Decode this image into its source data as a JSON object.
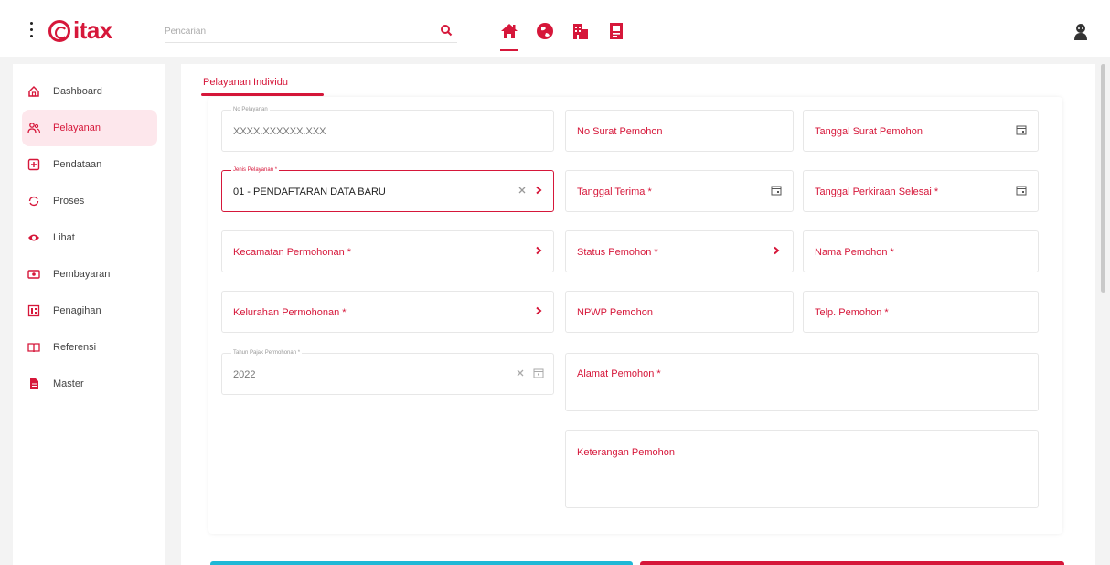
{
  "header": {
    "logo_text": "itax",
    "search": {
      "placeholder": "Pencarian"
    },
    "nav_icons": [
      "home-icon",
      "globe-icon",
      "building-icon",
      "document-icon"
    ],
    "active_nav": "home-icon"
  },
  "sidebar": {
    "items": [
      {
        "label": "Dashboard",
        "icon": "home-outline-icon",
        "active": false
      },
      {
        "label": "Pelayanan",
        "icon": "users-icon",
        "active": true
      },
      {
        "label": "Pendataan",
        "icon": "plus-square-icon",
        "active": false
      },
      {
        "label": "Proses",
        "icon": "refresh-icon",
        "active": false
      },
      {
        "label": "Lihat",
        "icon": "eye-icon",
        "active": false
      },
      {
        "label": "Pembayaran",
        "icon": "money-icon",
        "active": false
      },
      {
        "label": "Penagihan",
        "icon": "bill-icon",
        "active": false
      },
      {
        "label": "Referensi",
        "icon": "book-icon",
        "active": false
      },
      {
        "label": "Master",
        "icon": "file-icon",
        "active": false
      }
    ]
  },
  "tab": {
    "label": "Pelayanan Individu"
  },
  "form": {
    "no_pelayanan": {
      "label": "No Pelayanan",
      "value": "XXXX.XXXXXX.XXX"
    },
    "no_surat": {
      "placeholder": "No Surat Pemohon"
    },
    "tanggal_surat": {
      "placeholder": "Tanggal Surat Pemohon"
    },
    "jenis_pelayanan": {
      "label": "Jenis Pelayanan *",
      "value": "01 - PENDAFTARAN DATA BARU"
    },
    "tanggal_terima": {
      "placeholder": "Tanggal Terima *"
    },
    "tanggal_perkiraan": {
      "placeholder": "Tanggal Perkiraan Selesai *"
    },
    "kecamatan": {
      "placeholder": "Kecamatan Permohonan *"
    },
    "status_pemohon": {
      "placeholder": "Status Pemohon *"
    },
    "nama_pemohon": {
      "placeholder": "Nama Pemohon *"
    },
    "kelurahan": {
      "placeholder": "Kelurahan Permohonan *"
    },
    "npwp": {
      "placeholder": "NPWP Pemohon"
    },
    "telp": {
      "placeholder": "Telp. Pemohon *"
    },
    "tahun_pajak": {
      "label": "Tahun Pajak Permohonan *",
      "value": "2022"
    },
    "alamat": {
      "placeholder": "Alamat Pemohon *"
    },
    "keterangan": {
      "placeholder": "Keterangan Pemohon"
    }
  },
  "colors": {
    "accent": "#d6173a",
    "accent_soft": "#fde7ec",
    "cyan_button": "#1fb8d6",
    "red_button": "#d6173a"
  }
}
